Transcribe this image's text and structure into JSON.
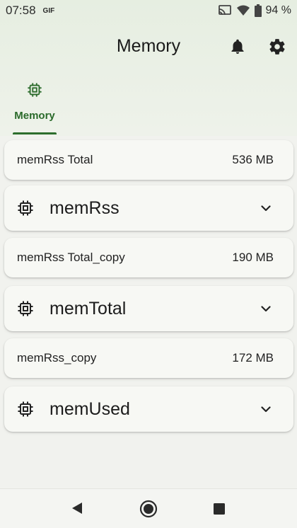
{
  "status_bar": {
    "time": "07:58",
    "gif_badge": "GIF",
    "battery": "94 %"
  },
  "app_bar": {
    "title": "Memory",
    "icons": [
      "bell-icon",
      "gear-icon"
    ]
  },
  "tabs": [
    {
      "label": "Memory",
      "icon": "chip-icon",
      "selected": true
    }
  ],
  "cards": {
    "stat1": {
      "label": "memRss Total",
      "value": "536 MB"
    },
    "group1": {
      "label": "memRss",
      "icon": "chip-icon"
    },
    "stat2": {
      "label": "memRss Total_copy",
      "value": "190 MB"
    },
    "group2": {
      "label": "memTotal",
      "icon": "chip-icon"
    },
    "stat3": {
      "label": "memRss_copy",
      "value": "172 MB"
    },
    "group3": {
      "label": "memUsed",
      "icon": "chip-icon"
    }
  },
  "nav_bar": {
    "icons": [
      "back-icon",
      "home-icon",
      "recents-icon"
    ]
  },
  "colors": {
    "accent": "#2d6e2d",
    "card_background": "#f7f8f4",
    "header_background": "#e6eee1"
  }
}
